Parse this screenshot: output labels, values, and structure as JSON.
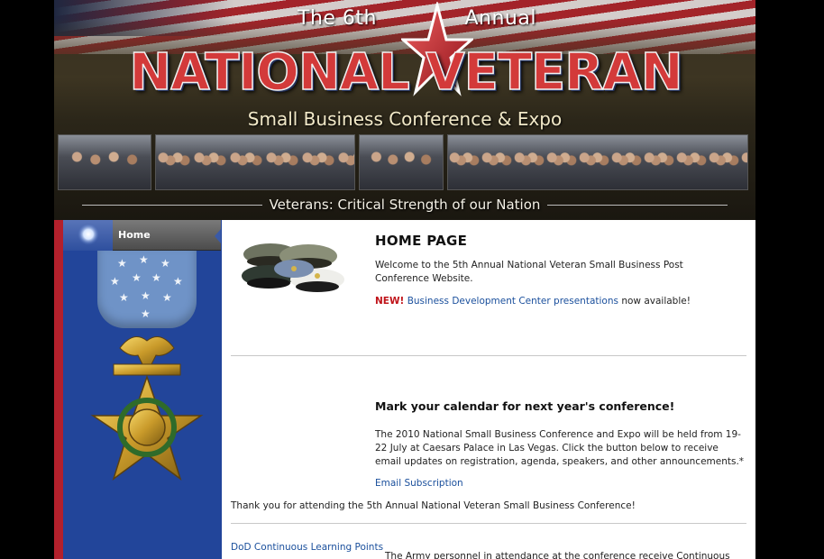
{
  "banner": {
    "top_left": "The 6th",
    "top_right": "Annual",
    "title": "NATIONAL VETERAN",
    "subtitle": "Small Business Conference & Expo",
    "tagline": "Veterans: Critical Strength of our Nation"
  },
  "nav": {
    "home_label": "Home"
  },
  "content": {
    "page_title": "HOME PAGE",
    "welcome": "Welcome to the 5th Annual National Veteran Small Business Post Conference Website.",
    "new_tag": "NEW!",
    "news_link": "Business Development Center presentations",
    "news_suffix": "now available!",
    "calendar_title": "Mark your calendar for next year's conference!",
    "calendar_body": "The 2010 National Small Business Conference and Expo will be held from 19-22 July at Caesars Palace in Las Vegas. Click the button below to receive email updates on registration, agenda, speakers, and other announcements.*",
    "email_link": "Email Subscription",
    "thanks": "Thank you for attending the 5th Annual National Veteran Small Business Conference!",
    "dod_link": "DoD Continuous Learning Points",
    "army_text": "The Army personnel in attendance at the conference receive Continuous"
  },
  "colors": {
    "sidebar_blue": "#22459a",
    "sidebar_red": "#b3202c",
    "link_blue": "#1a4f9c",
    "new_red": "#c0141a"
  },
  "icons": {
    "nav_home": "glowing-orb-icon",
    "medal": "medal-of-honor-image",
    "hats": "military-caps-image",
    "star": "star-emblem-icon"
  }
}
